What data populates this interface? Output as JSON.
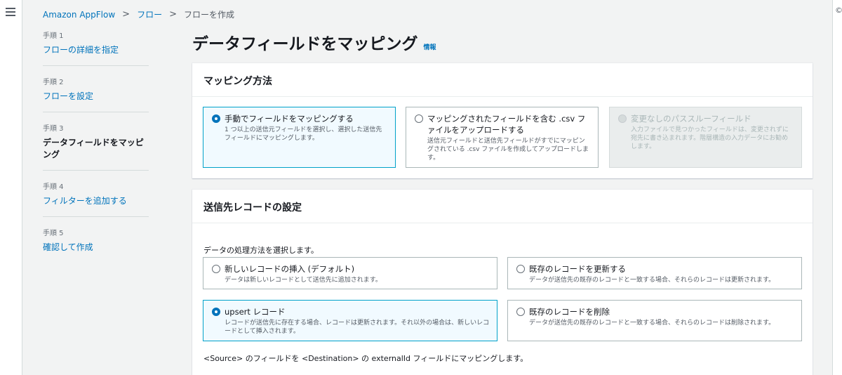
{
  "breadcrumb": {
    "items": [
      "Amazon AppFlow",
      "フロー",
      "フローを作成"
    ]
  },
  "steps": [
    {
      "num": "手順 1",
      "label": "フローの詳細を指定"
    },
    {
      "num": "手順 2",
      "label": "フローを設定"
    },
    {
      "num": "手順 3",
      "label": "データフィールドをマッピング"
    },
    {
      "num": "手順 4",
      "label": "フィルターを追加する"
    },
    {
      "num": "手順 5",
      "label": "確認して作成"
    }
  ],
  "page": {
    "title": "データフィールドをマッピング",
    "info": "情報"
  },
  "mapping": {
    "heading": "マッピング方法",
    "options": [
      {
        "title": "手動でフィールドをマッピングする",
        "desc": "1 つ以上の送信元フィールドを選択し、選択した送信先フィールドにマッピングします。"
      },
      {
        "title": "マッピングされたフィールドを含む .csv ファイルをアップロードする",
        "desc": "送信元フィールドと送信先フィールドがすでにマッピングされている .csv ファイルを作成してアップロードします。"
      },
      {
        "title": "変更なしのパススルーフィールド",
        "desc": "入力ファイルで見つかったフィールドは、変更されずに宛先に書き込まれます。階層構造の入力データにお勧めします。"
      }
    ]
  },
  "destination": {
    "heading": "送信先レコードの設定",
    "prompt": "データの処理方法を選択します。",
    "options": [
      {
        "title": "新しいレコードの挿入 (デフォルト)",
        "desc": "データは新しいレコードとして送信先に追加されます。"
      },
      {
        "title": "既存のレコードを更新する",
        "desc": "データが送信先の既存のレコードと一致する場合、それらのレコードは更新されます。"
      },
      {
        "title": "upsert レコード",
        "desc": "レコードが送信先に存在する場合、レコードは更新されます。それ以外の場合は、新しいレコードとして挿入されます。"
      },
      {
        "title": "既存のレコードを削除",
        "desc": "データが送信先の既存のレコードと一致する場合、それらのレコードは削除されます。"
      }
    ],
    "footnote": "<Source> のフィールドを <Destination> の externalId フィールドにマッピングします。"
  },
  "icons": {
    "menu": "hamburger-menu-icon",
    "help": "help-icon"
  },
  "colors": {
    "link": "#0073bb",
    "selected_border": "#00a1c9",
    "selected_bg": "#f1faff"
  }
}
